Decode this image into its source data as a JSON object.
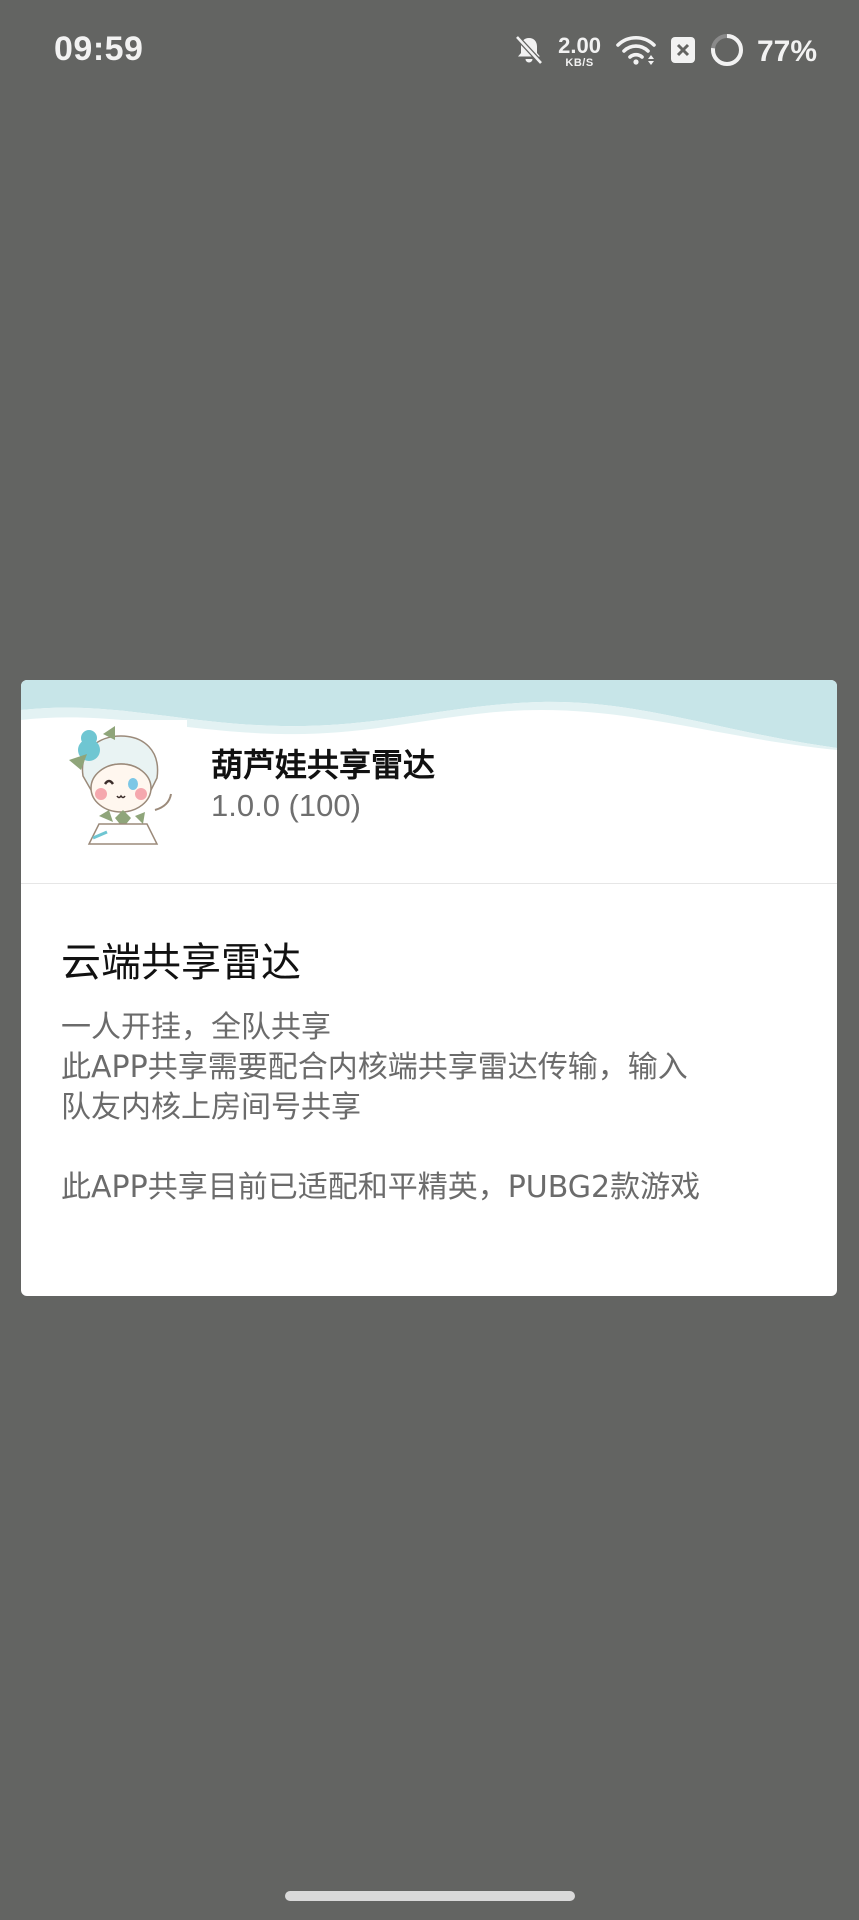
{
  "status_bar": {
    "time": "09:59",
    "net_speed_value": "2.00",
    "net_speed_unit": "KB/S",
    "battery_percent": "77%",
    "icons": [
      "bell-muted-icon",
      "wifi-icon",
      "close-box-icon",
      "battery-ring-icon"
    ]
  },
  "dialog": {
    "app_name": "葫芦娃共享雷达",
    "app_version": "1.0.0 (100)",
    "title": "云端共享雷达",
    "body_lines": [
      "一人开挂，全队共享",
      "此APP共享需要配合内核端共享雷达传输，输入",
      "队友内核上房间号共享",
      "此APP共享目前已适配和平精英，PUBG2款游戏"
    ]
  },
  "colors": {
    "scrim": "#636462",
    "dialog_bg": "#ffffff",
    "wave": "#c7e5e8",
    "text_primary": "#111111",
    "text_secondary": "#6b6b6b"
  }
}
